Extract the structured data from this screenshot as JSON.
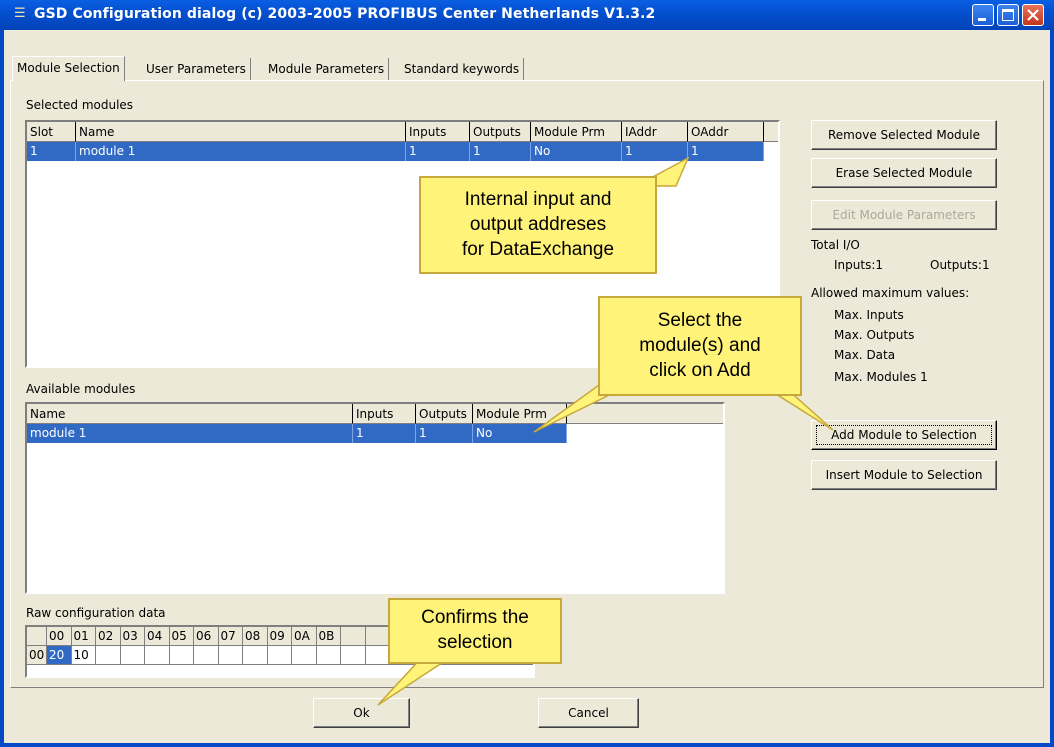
{
  "window": {
    "title": "GSD Configuration dialog (c) 2003-2005 PROFIBUS Center Netherlands V1.3.2",
    "icons": {
      "app": "app-icon",
      "minimize": "minimize-icon",
      "maximize": "maximize-icon",
      "close": "close-icon"
    }
  },
  "tabs": [
    {
      "label": "Module Selection",
      "active": true
    },
    {
      "label": "User Parameters"
    },
    {
      "label": "Module Parameters"
    },
    {
      "label": "Standard keywords"
    }
  ],
  "selected_modules": {
    "label": "Selected modules",
    "columns": [
      "Slot",
      "Name",
      "Inputs",
      "Outputs",
      "Module Prm",
      "IAddr",
      "OAddr"
    ],
    "rows": [
      [
        "1",
        "module 1",
        "1",
        "1",
        "No",
        "1",
        "1"
      ]
    ]
  },
  "available_modules": {
    "label": "Available modules",
    "columns": [
      "Name",
      "Inputs",
      "Outputs",
      "Module Prm"
    ],
    "rows": [
      [
        "module 1",
        "1",
        "1",
        "No"
      ]
    ]
  },
  "raw_config": {
    "label": "Raw configuration data",
    "columns": [
      "00",
      "01",
      "02",
      "03",
      "04",
      "05",
      "06",
      "07",
      "08",
      "09",
      "0A",
      "0B"
    ],
    "row_header": "00",
    "values": [
      "20",
      "10"
    ]
  },
  "buttons": {
    "remove": "Remove Selected Module",
    "erase": "Erase Selected Module",
    "edit": "Edit Module Parameters",
    "add": "Add Module to Selection",
    "insert": "Insert Module to Selection",
    "ok": "Ok",
    "cancel": "Cancel"
  },
  "io_info": {
    "total_label": "Total I/O",
    "inputs": "Inputs:1",
    "outputs": "Outputs:1",
    "allowed_label": "Allowed maximum values:",
    "max_inputs": "Max. Inputs",
    "max_outputs": "Max. Outputs",
    "max_data": "Max. Data",
    "max_modules": "Max. Modules  1"
  },
  "callouts": {
    "addresses": [
      "Internal input and",
      "output addreses",
      "for DataExchange"
    ],
    "select": [
      "Select the",
      "module(s) and",
      "click on Add"
    ],
    "confirm": [
      "Confirms the",
      "selection"
    ],
    "color": "#FFF37A"
  },
  "colors": {
    "selection": "#316AC5",
    "titlebar": "#0450D0",
    "dialog": "#ECE9D8"
  }
}
